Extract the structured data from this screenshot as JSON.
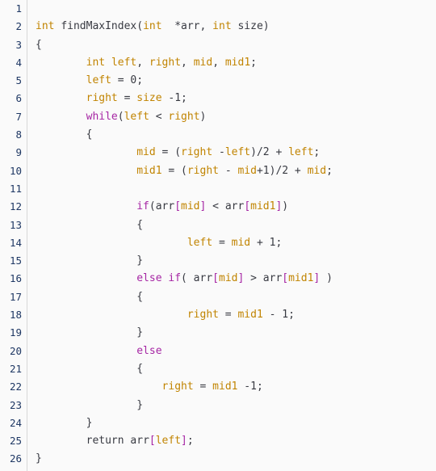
{
  "editor": {
    "language": "c",
    "background_color": "#fafafa",
    "gutter_divider_color": "#d8d8d8",
    "line_number_color": "#1f3864",
    "plain_text_color": "#383a42",
    "keyword_color": "#a626a4",
    "variable_color": "#c18401",
    "bracket_color": "#a626a4",
    "total_lines": 26
  },
  "gutter": {
    "line_numbers": [
      "1",
      "2",
      "3",
      "4",
      "5",
      "6",
      "7",
      "8",
      "9",
      "10",
      "11",
      "12",
      "13",
      "14",
      "15",
      "16",
      "17",
      "18",
      "19",
      "20",
      "21",
      "22",
      "23",
      "24",
      "25",
      "26"
    ]
  },
  "code": {
    "lines": [
      {
        "n": 1,
        "tokens": []
      },
      {
        "n": 2,
        "tokens": [
          {
            "t": "typ",
            "v": "int"
          },
          {
            "t": "pln",
            "v": " "
          },
          {
            "t": "pln",
            "v": "findMaxIndex("
          },
          {
            "t": "typ",
            "v": "int"
          },
          {
            "t": "pln",
            "v": "  *arr, "
          },
          {
            "t": "typ",
            "v": "int"
          },
          {
            "t": "pln",
            "v": " size)"
          }
        ]
      },
      {
        "n": 3,
        "tokens": [
          {
            "t": "pln",
            "v": "{"
          }
        ]
      },
      {
        "n": 4,
        "tokens": [
          {
            "t": "pln",
            "v": "        "
          },
          {
            "t": "typ",
            "v": "int"
          },
          {
            "t": "pln",
            "v": " "
          },
          {
            "t": "var",
            "v": "left"
          },
          {
            "t": "pln",
            "v": ", "
          },
          {
            "t": "var",
            "v": "right"
          },
          {
            "t": "pln",
            "v": ", "
          },
          {
            "t": "var",
            "v": "mid"
          },
          {
            "t": "pln",
            "v": ", "
          },
          {
            "t": "var",
            "v": "mid1"
          },
          {
            "t": "pln",
            "v": ";"
          }
        ]
      },
      {
        "n": 5,
        "tokens": [
          {
            "t": "pln",
            "v": "        "
          },
          {
            "t": "var",
            "v": "left"
          },
          {
            "t": "pln",
            "v": " = "
          },
          {
            "t": "num",
            "v": "0"
          },
          {
            "t": "pln",
            "v": ";"
          }
        ]
      },
      {
        "n": 6,
        "tokens": [
          {
            "t": "pln",
            "v": "        "
          },
          {
            "t": "var",
            "v": "right"
          },
          {
            "t": "pln",
            "v": " = "
          },
          {
            "t": "var",
            "v": "size"
          },
          {
            "t": "pln",
            "v": " -"
          },
          {
            "t": "num",
            "v": "1"
          },
          {
            "t": "pln",
            "v": ";"
          }
        ]
      },
      {
        "n": 7,
        "tokens": [
          {
            "t": "pln",
            "v": "        "
          },
          {
            "t": "kw",
            "v": "while"
          },
          {
            "t": "pln",
            "v": "("
          },
          {
            "t": "var",
            "v": "left"
          },
          {
            "t": "pln",
            "v": " < "
          },
          {
            "t": "var",
            "v": "right"
          },
          {
            "t": "pln",
            "v": ")"
          }
        ]
      },
      {
        "n": 8,
        "tokens": [
          {
            "t": "pln",
            "v": "        {"
          }
        ]
      },
      {
        "n": 9,
        "tokens": [
          {
            "t": "pln",
            "v": "                "
          },
          {
            "t": "var",
            "v": "mid"
          },
          {
            "t": "pln",
            "v": " = ("
          },
          {
            "t": "var",
            "v": "right"
          },
          {
            "t": "pln",
            "v": " -"
          },
          {
            "t": "var",
            "v": "left"
          },
          {
            "t": "pln",
            "v": ")/"
          },
          {
            "t": "num",
            "v": "2"
          },
          {
            "t": "pln",
            "v": " + "
          },
          {
            "t": "var",
            "v": "left"
          },
          {
            "t": "pln",
            "v": ";"
          }
        ]
      },
      {
        "n": 10,
        "tokens": [
          {
            "t": "pln",
            "v": "                "
          },
          {
            "t": "var",
            "v": "mid1"
          },
          {
            "t": "pln",
            "v": " = ("
          },
          {
            "t": "var",
            "v": "right"
          },
          {
            "t": "pln",
            "v": " - "
          },
          {
            "t": "var",
            "v": "mid"
          },
          {
            "t": "pln",
            "v": "+"
          },
          {
            "t": "num",
            "v": "1"
          },
          {
            "t": "pln",
            "v": ")/"
          },
          {
            "t": "num",
            "v": "2"
          },
          {
            "t": "pln",
            "v": " + "
          },
          {
            "t": "var",
            "v": "mid"
          },
          {
            "t": "pln",
            "v": ";"
          }
        ]
      },
      {
        "n": 11,
        "tokens": []
      },
      {
        "n": 12,
        "tokens": [
          {
            "t": "pln",
            "v": "                "
          },
          {
            "t": "kw",
            "v": "if"
          },
          {
            "t": "pln",
            "v": "(arr"
          },
          {
            "t": "brk",
            "v": "["
          },
          {
            "t": "var",
            "v": "mid"
          },
          {
            "t": "brk",
            "v": "]"
          },
          {
            "t": "pln",
            "v": " < arr"
          },
          {
            "t": "brk",
            "v": "["
          },
          {
            "t": "var",
            "v": "mid1"
          },
          {
            "t": "brk",
            "v": "]"
          },
          {
            "t": "pln",
            "v": ")"
          }
        ]
      },
      {
        "n": 13,
        "tokens": [
          {
            "t": "pln",
            "v": "                {"
          }
        ]
      },
      {
        "n": 14,
        "tokens": [
          {
            "t": "pln",
            "v": "                        "
          },
          {
            "t": "var",
            "v": "left"
          },
          {
            "t": "pln",
            "v": " = "
          },
          {
            "t": "var",
            "v": "mid"
          },
          {
            "t": "pln",
            "v": " + "
          },
          {
            "t": "num",
            "v": "1"
          },
          {
            "t": "pln",
            "v": ";"
          }
        ]
      },
      {
        "n": 15,
        "tokens": [
          {
            "t": "pln",
            "v": "                }"
          }
        ]
      },
      {
        "n": 16,
        "tokens": [
          {
            "t": "pln",
            "v": "                "
          },
          {
            "t": "kw",
            "v": "else"
          },
          {
            "t": "pln",
            "v": " "
          },
          {
            "t": "kw",
            "v": "if"
          },
          {
            "t": "pln",
            "v": "( arr"
          },
          {
            "t": "brk",
            "v": "["
          },
          {
            "t": "var",
            "v": "mid"
          },
          {
            "t": "brk",
            "v": "]"
          },
          {
            "t": "pln",
            "v": " > arr"
          },
          {
            "t": "brk",
            "v": "["
          },
          {
            "t": "var",
            "v": "mid1"
          },
          {
            "t": "brk",
            "v": "]"
          },
          {
            "t": "pln",
            "v": " )"
          }
        ]
      },
      {
        "n": 17,
        "tokens": [
          {
            "t": "pln",
            "v": "                {"
          }
        ]
      },
      {
        "n": 18,
        "tokens": [
          {
            "t": "pln",
            "v": "                        "
          },
          {
            "t": "var",
            "v": "right"
          },
          {
            "t": "pln",
            "v": " = "
          },
          {
            "t": "var",
            "v": "mid1"
          },
          {
            "t": "pln",
            "v": " - "
          },
          {
            "t": "num",
            "v": "1"
          },
          {
            "t": "pln",
            "v": ";"
          }
        ]
      },
      {
        "n": 19,
        "tokens": [
          {
            "t": "pln",
            "v": "                }"
          }
        ]
      },
      {
        "n": 20,
        "tokens": [
          {
            "t": "pln",
            "v": "                "
          },
          {
            "t": "kw",
            "v": "else"
          }
        ]
      },
      {
        "n": 21,
        "tokens": [
          {
            "t": "pln",
            "v": "                {"
          }
        ]
      },
      {
        "n": 22,
        "tokens": [
          {
            "t": "pln",
            "v": "                    "
          },
          {
            "t": "var",
            "v": "right"
          },
          {
            "t": "pln",
            "v": " = "
          },
          {
            "t": "var",
            "v": "mid1"
          },
          {
            "t": "pln",
            "v": " -"
          },
          {
            "t": "num",
            "v": "1"
          },
          {
            "t": "pln",
            "v": ";"
          }
        ]
      },
      {
        "n": 23,
        "tokens": [
          {
            "t": "pln",
            "v": "                }"
          }
        ]
      },
      {
        "n": 24,
        "tokens": [
          {
            "t": "pln",
            "v": "        }"
          }
        ]
      },
      {
        "n": 25,
        "tokens": [
          {
            "t": "pln",
            "v": "        "
          },
          {
            "t": "pln",
            "v": "return"
          },
          {
            "t": "pln",
            "v": " arr"
          },
          {
            "t": "brk",
            "v": "["
          },
          {
            "t": "var",
            "v": "left"
          },
          {
            "t": "brk",
            "v": "]"
          },
          {
            "t": "pln",
            "v": ";"
          }
        ]
      },
      {
        "n": 26,
        "tokens": [
          {
            "t": "pln",
            "v": "}"
          }
        ]
      }
    ]
  }
}
